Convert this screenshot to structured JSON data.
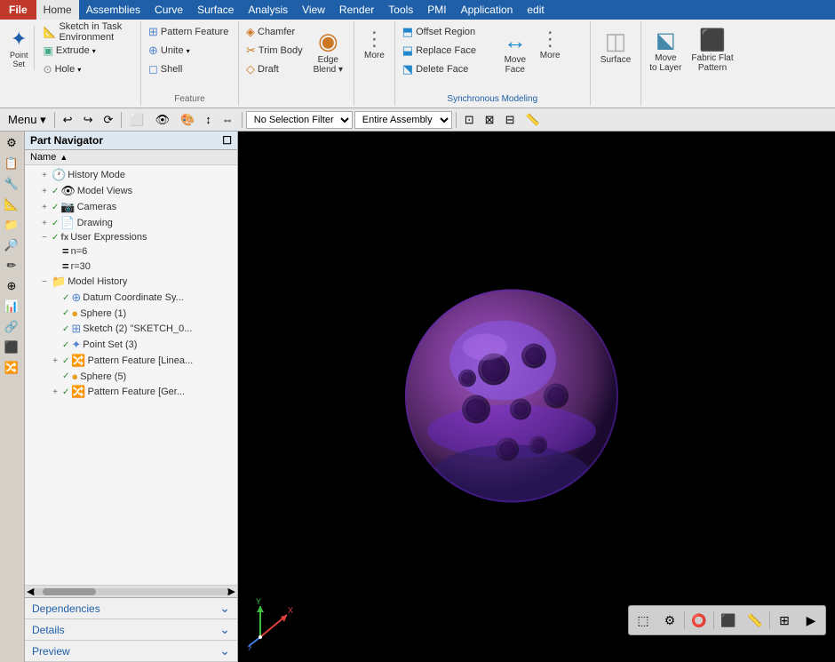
{
  "menubar": {
    "file_label": "File",
    "tabs": [
      "Home",
      "Assemblies",
      "Curve",
      "Surface",
      "Analysis",
      "View",
      "Render",
      "Tools",
      "PMI",
      "Application",
      "edit"
    ]
  },
  "ribbon": {
    "active_tab": "Home",
    "groups": [
      {
        "name": "insert",
        "label": "",
        "buttons": [
          {
            "id": "point-set",
            "icon": "✦",
            "label": "Point\nSet",
            "large": true
          },
          {
            "id": "sketch",
            "icon": "📐",
            "label": "Sketch in Task\nEnvironment",
            "large": false
          },
          {
            "id": "extrude",
            "icon": "⬛",
            "label": "Extrude",
            "large": false
          },
          {
            "id": "hole",
            "icon": "⭕",
            "label": "Hole",
            "large": false
          }
        ]
      },
      {
        "name": "feature",
        "label": "Feature",
        "buttons": [
          {
            "id": "pattern-feature",
            "icon": "⊞",
            "label": "Pattern Feature",
            "small": true
          },
          {
            "id": "unite",
            "icon": "⊕",
            "label": "Unite ▾",
            "small": true
          },
          {
            "id": "shell",
            "icon": "◻",
            "label": "Shell",
            "small": true
          }
        ]
      },
      {
        "name": "edge",
        "label": "",
        "buttons": [
          {
            "id": "chamfer",
            "icon": "◈",
            "label": "Chamfer",
            "small": true
          },
          {
            "id": "trim-body",
            "icon": "✂",
            "label": "Trim Body",
            "small": true
          },
          {
            "id": "draft",
            "icon": "◇",
            "label": "Draft",
            "small": true
          },
          {
            "id": "edge-blend",
            "icon": "◉",
            "label": "Edge\nBlend ▾",
            "large": true
          }
        ]
      },
      {
        "name": "more1",
        "label": "",
        "buttons": [
          {
            "id": "more1",
            "icon": "▼",
            "label": "More",
            "large": true
          }
        ]
      },
      {
        "name": "sync-modeling",
        "label": "Synchronous Modeling",
        "sublabel": true,
        "buttons": [
          {
            "id": "offset-region",
            "icon": "⬒",
            "label": "Offset Region",
            "small": true
          },
          {
            "id": "replace-face",
            "icon": "⬓",
            "label": "Replace Face",
            "small": true
          },
          {
            "id": "delete-face",
            "icon": "⬔",
            "label": "Delete Face",
            "small": true
          },
          {
            "id": "move-face",
            "icon": "↔",
            "label": "Move\nFace",
            "large": true
          },
          {
            "id": "more2",
            "icon": "▼",
            "label": "More",
            "large": true
          }
        ]
      },
      {
        "name": "surface-group",
        "label": "",
        "buttons": [
          {
            "id": "surface",
            "icon": "◫",
            "label": "Surface",
            "large": true
          }
        ]
      },
      {
        "name": "layer-group",
        "label": "",
        "buttons": [
          {
            "id": "move-to-layer",
            "icon": "⬕",
            "label": "Move\nto Layer",
            "large": true
          },
          {
            "id": "fabric-flat",
            "icon": "⬛",
            "label": "Fabric Flat\nPattern",
            "large": true
          }
        ]
      }
    ]
  },
  "toolbar": {
    "menu_label": "Menu ▾",
    "selection_filter": "No Selection Filter",
    "assembly_filter": "Entire Assembly"
  },
  "part_navigator": {
    "title": "Part Navigator",
    "col_header": "Name",
    "items": [
      {
        "id": "history-mode",
        "indent": 1,
        "exp": "+",
        "icon": "🕐",
        "check": "",
        "name": "History Mode"
      },
      {
        "id": "model-views",
        "indent": 1,
        "exp": "+",
        "icon": "👁",
        "check": "✓",
        "name": "Model Views"
      },
      {
        "id": "cameras",
        "indent": 1,
        "exp": "+",
        "icon": "📷",
        "check": "✓",
        "name": "Cameras"
      },
      {
        "id": "drawing",
        "indent": 1,
        "exp": "+",
        "icon": "📄",
        "check": "✓",
        "name": "Drawing"
      },
      {
        "id": "user-expressions",
        "indent": 1,
        "exp": "-",
        "icon": "fx",
        "check": "✓",
        "name": "User Expressions"
      },
      {
        "id": "expr-n",
        "indent": 2,
        "exp": "",
        "icon": "=",
        "check": "",
        "name": "n=6"
      },
      {
        "id": "expr-r",
        "indent": 2,
        "exp": "",
        "icon": "=",
        "check": "",
        "name": "r=30"
      },
      {
        "id": "model-history",
        "indent": 1,
        "exp": "-",
        "icon": "📁",
        "check": "",
        "name": "Model History"
      },
      {
        "id": "datum-coord",
        "indent": 2,
        "exp": "",
        "icon": "⊕",
        "check": "✓",
        "name": "Datum Coordinate Sy..."
      },
      {
        "id": "sphere1",
        "indent": 2,
        "exp": "",
        "icon": "🟡",
        "check": "✓",
        "name": "Sphere (1)"
      },
      {
        "id": "sketch2",
        "indent": 2,
        "exp": "",
        "icon": "⊞",
        "check": "✓",
        "name": "Sketch (2) \"SKETCH_0..."
      },
      {
        "id": "point-set3",
        "indent": 2,
        "exp": "",
        "icon": "✦",
        "check": "✓",
        "name": "Point Set (3)"
      },
      {
        "id": "pattern-linear",
        "indent": 2,
        "exp": "+",
        "icon": "⊞",
        "check": "✓",
        "name": "Pattern Feature [Linea..."
      },
      {
        "id": "sphere5",
        "indent": 2,
        "exp": "",
        "icon": "🟡",
        "check": "✓",
        "name": "Sphere (5)"
      },
      {
        "id": "pattern-gen",
        "indent": 2,
        "exp": "+",
        "icon": "⊞",
        "check": "✓",
        "name": "Pattern Feature [Ger..."
      }
    ]
  },
  "bottom_panels": [
    {
      "id": "dependencies",
      "label": "Dependencies",
      "expanded": false
    },
    {
      "id": "details",
      "label": "Details",
      "expanded": false
    },
    {
      "id": "preview",
      "label": "Preview",
      "expanded": false
    }
  ],
  "viewport": {
    "bg_color": "#000000"
  },
  "vp_toolbar": {
    "buttons": [
      "🔲",
      "⚙",
      "⭕",
      "▦",
      "📏",
      "⊞"
    ]
  },
  "colors": {
    "accent": "#1e5fa8",
    "file_bg": "#c0392b",
    "ribbon_bg": "#f0f0f0",
    "active_tab": "#1e5fa8"
  }
}
